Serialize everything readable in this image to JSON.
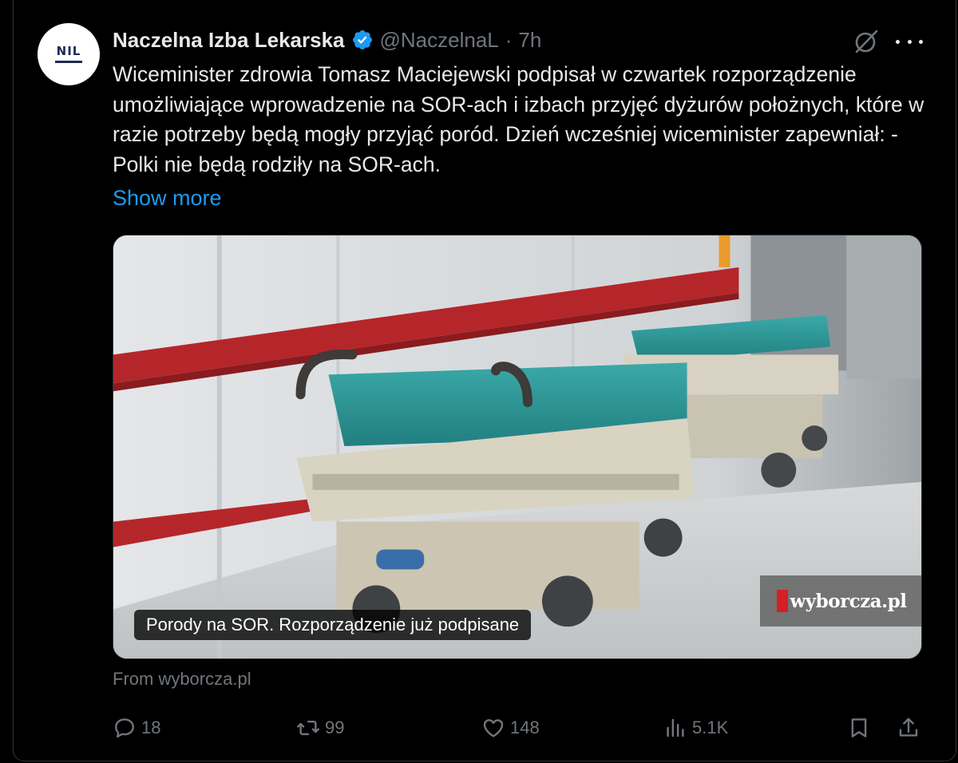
{
  "tweet": {
    "author_name": "Naczelna Izba Lekarska",
    "handle": "@NaczelnaL",
    "separator": "·",
    "time": "7h",
    "avatar_text": "NIL",
    "text": "Wiceminister zdrowia Tomasz Maciejewski podpisał w czwartek rozporządzenie umożliwiające wprowadzenie na SOR-ach i izbach przyjęć dyżurów położnych, które w razie potrzeby będą mogły przyjąć poród. Dzień wcześniej wiceminister zapewniał: - Polki nie będą rodziły na SOR-ach.",
    "show_more": "Show more",
    "verified_icon": "verified-badge-icon",
    "accent_color": "#1d9bf0"
  },
  "card": {
    "caption": "Porody na SOR. Rozporządzenie już podpisane",
    "brand": "wyborcza.pl",
    "source": "From wyborcza.pl",
    "image_description_icon": "hospital-stretchers-photo"
  },
  "actions": {
    "replies": "18",
    "reposts": "99",
    "likes": "148",
    "views": "5.1K",
    "icons": [
      "reply-icon",
      "repost-icon",
      "like-icon",
      "views-icon",
      "bookmark-icon",
      "share-icon"
    ]
  },
  "top_icons": [
    "grok-icon",
    "more-icon"
  ]
}
